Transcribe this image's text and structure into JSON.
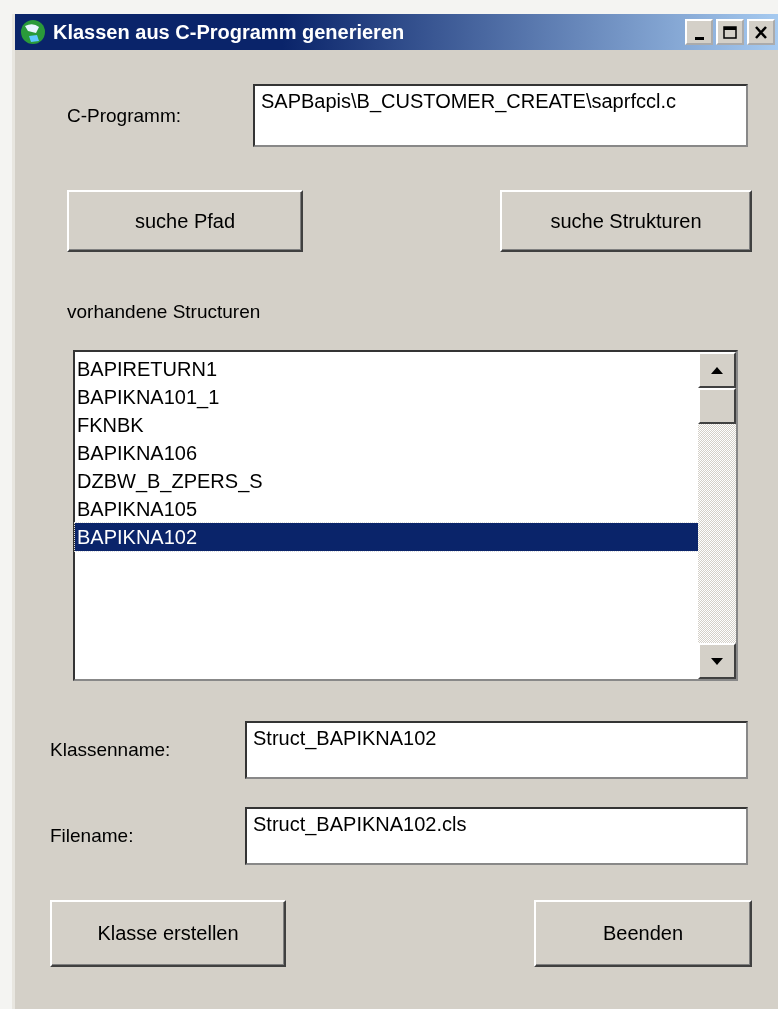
{
  "window": {
    "title": "Klassen aus C-Programm generieren"
  },
  "window_controls": [
    {
      "kind": "minimize"
    },
    {
      "kind": "maximize"
    },
    {
      "kind": "close"
    }
  ],
  "source": {
    "label": "C-Programm:",
    "value": "SAPBapis\\B_CUSTOMER_CREATE\\saprfccl.c"
  },
  "search_buttons": [
    "suche Pfad",
    "suche Strukturen"
  ],
  "structures": {
    "label": "vorhandene Structuren",
    "items": [
      {
        "text": "BAPIRETURN1",
        "selected": false
      },
      {
        "text": "BAPIKNA101_1",
        "selected": false
      },
      {
        "text": "FKNBK",
        "selected": false
      },
      {
        "text": "BAPIKNA106",
        "selected": false
      },
      {
        "text": "DZBW_B_ZPERS_S",
        "selected": false
      },
      {
        "text": "BAPIKNA105",
        "selected": false
      },
      {
        "text": "BAPIKNA102",
        "selected": true
      }
    ]
  },
  "fields": [
    {
      "label": "Klassenname:",
      "value": "Struct_BAPIKNA102"
    },
    {
      "label": "Filename:",
      "value": "Struct_BAPIKNA102.cls"
    }
  ],
  "action_buttons": [
    "Klasse erstellen",
    "Beenden"
  ]
}
